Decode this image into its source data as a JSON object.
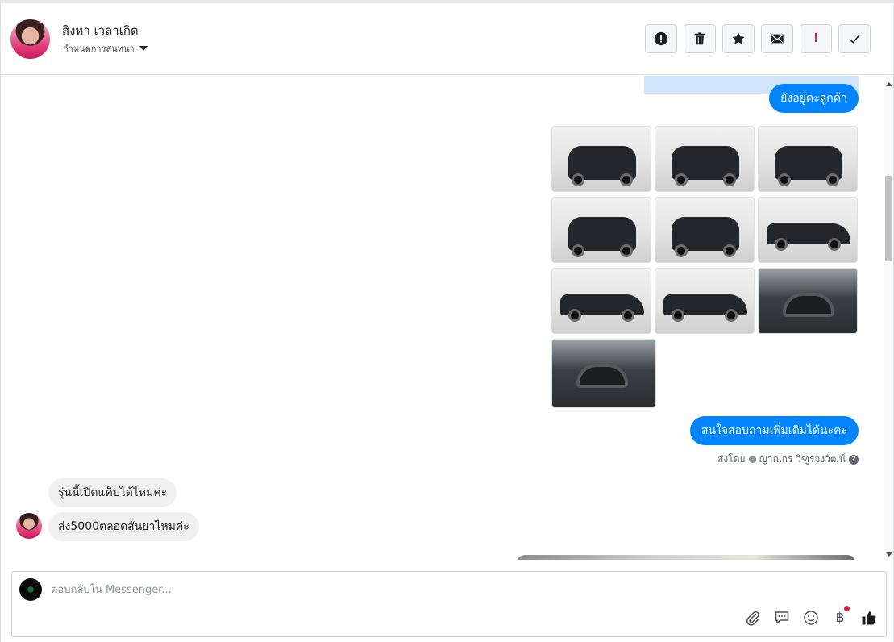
{
  "header": {
    "customer_name": "สิงหา เวลาเกิด",
    "assign_label": "กำหนดการสนทนา",
    "toolbar": [
      {
        "name": "spam-button",
        "icon": "alert-icon"
      },
      {
        "name": "delete-button",
        "icon": "trash-icon"
      },
      {
        "name": "star-button",
        "icon": "star-icon"
      },
      {
        "name": "mark-unread-button",
        "icon": "envelope-icon"
      },
      {
        "name": "follow-up-button",
        "icon": "exclamation-icon"
      },
      {
        "name": "mark-done-button",
        "icon": "check-icon"
      }
    ]
  },
  "thread": {
    "messages_out": [
      {
        "text": "ยังอยู่คะลูกค้า"
      },
      {
        "text": "สนใจสอบถามเพิ่มเติมได้นะคะ"
      }
    ],
    "sent_by_prefix": "ส่งโดย",
    "sent_by_name": "ญาณกร วิฑูรจงวัฒน์",
    "help_mark": "?",
    "messages_in": [
      {
        "text": "รุ่นนี้เปิดแค็ปได้ไหมค่ะ"
      },
      {
        "text": "ส่ง5000ตลอดสันยาไหมค่ะ"
      }
    ],
    "photo_count": 10
  },
  "composer": {
    "placeholder": "ตอบกลับใน Messenger...",
    "baht_symbol": "฿",
    "follow_up_mark": "!"
  },
  "colors": {
    "outgoing_bubble": "#0084ff",
    "incoming_bubble": "#f1f0f0",
    "alert_red": "#e41e3f"
  }
}
